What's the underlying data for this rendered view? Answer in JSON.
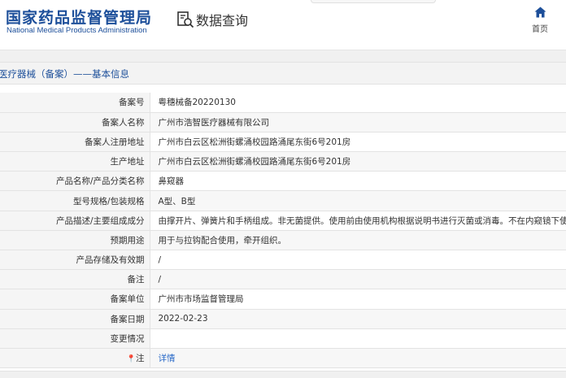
{
  "header": {
    "logo_cn": "国家药品监督管理局",
    "logo_en": "National Medical Products Administration",
    "query_label": "数据查询",
    "home_label": "首页"
  },
  "section_title": "医疗器械（备案）——基本信息",
  "rows": [
    {
      "key": "备案号",
      "value": "粤穗械备20220130"
    },
    {
      "key": "备案人名称",
      "value": "广州市浩智医疗器械有限公司"
    },
    {
      "key": "备案人注册地址",
      "value": "广州市白云区松洲街螺涌校园路涌尾东街6号201房"
    },
    {
      "key": "生产地址",
      "value": "广州市白云区松洲街螺涌校园路涌尾东街6号201房"
    },
    {
      "key": "产品名称/产品分类名称",
      "value": "鼻窥器"
    },
    {
      "key": "型号规格/包装规格",
      "value": "A型、B型"
    },
    {
      "key": "产品描述/主要组成成分",
      "value": "由撑开片、弹簧片和手柄组成。非无菌提供。使用前由使用机构根据说明书进行灭菌或消毒。不在内窥镜下使用。"
    },
    {
      "key": "预期用途",
      "value": "用于与拉钩配合使用，牵开组织。"
    },
    {
      "key": "产品存储及有效期",
      "value": "/"
    },
    {
      "key": "备注",
      "value": "/"
    },
    {
      "key": "备案单位",
      "value": "广州市市场监督管理局"
    },
    {
      "key": "备案日期",
      "value": "2022-02-23"
    },
    {
      "key": "变更情况",
      "value": ""
    },
    {
      "key": "注",
      "value": "详情"
    }
  ],
  "colors": {
    "brand": "#1d4f9a",
    "link": "#2a6ac8"
  },
  "icons": {
    "query": "search-document-icon",
    "home": "home-icon",
    "note": "pin-icon"
  }
}
